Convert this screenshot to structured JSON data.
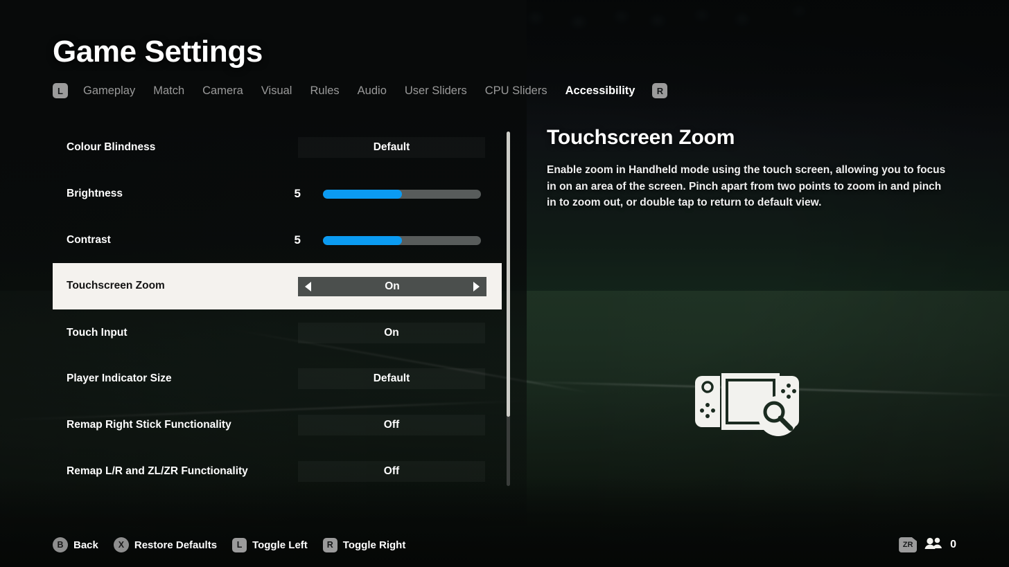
{
  "header": {
    "title": "Game Settings",
    "left_bumper": "L",
    "right_bumper": "R",
    "tabs": [
      {
        "label": "Gameplay",
        "active": false
      },
      {
        "label": "Match",
        "active": false
      },
      {
        "label": "Camera",
        "active": false
      },
      {
        "label": "Visual",
        "active": false
      },
      {
        "label": "Rules",
        "active": false
      },
      {
        "label": "Audio",
        "active": false
      },
      {
        "label": "User Sliders",
        "active": false
      },
      {
        "label": "CPU Sliders",
        "active": false
      },
      {
        "label": "Accessibility",
        "active": true
      }
    ]
  },
  "settings": {
    "rows": [
      {
        "label": "Colour Blindness",
        "type": "option",
        "value": "Default",
        "selected": false
      },
      {
        "label": "Brightness",
        "type": "slider",
        "value": "5",
        "percent": 50,
        "selected": false
      },
      {
        "label": "Contrast",
        "type": "slider",
        "value": "5",
        "percent": 50,
        "selected": false
      },
      {
        "label": "Touchscreen Zoom",
        "type": "option",
        "value": "On",
        "selected": true
      },
      {
        "label": "Touch Input",
        "type": "option",
        "value": "On",
        "selected": false
      },
      {
        "label": "Player Indicator Size",
        "type": "option",
        "value": "Default",
        "selected": false
      },
      {
        "label": "Remap Right Stick Functionality",
        "type": "option",
        "value": "Off",
        "selected": false
      },
      {
        "label": "Remap L/R and ZL/ZR Functionality",
        "type": "option",
        "value": "Off",
        "selected": false
      }
    ]
  },
  "detail": {
    "title": "Touchscreen Zoom",
    "description": "Enable zoom in Handheld mode using the touch screen, allowing you to focus in on an area of the screen. Pinch apart from two points to zoom in and pinch in to zoom out, or double tap to return to default view.",
    "art": "switch-handheld-zoom-icon"
  },
  "footer": {
    "hints": [
      {
        "button": "B",
        "shape": "round",
        "label": "Back"
      },
      {
        "button": "X",
        "shape": "round",
        "label": "Restore Defaults"
      },
      {
        "button": "L",
        "shape": "square",
        "label": "Toggle Left"
      },
      {
        "button": "R",
        "shape": "square",
        "label": "Toggle Right"
      }
    ],
    "zr_button": "ZR",
    "players_count": "0"
  },
  "colors": {
    "accent_slider": "#0b9bf2",
    "selected_row_bg": "#f4f2ee",
    "selected_value_bg": "#4b4f4d",
    "button_badge": "#9b9b9b"
  }
}
